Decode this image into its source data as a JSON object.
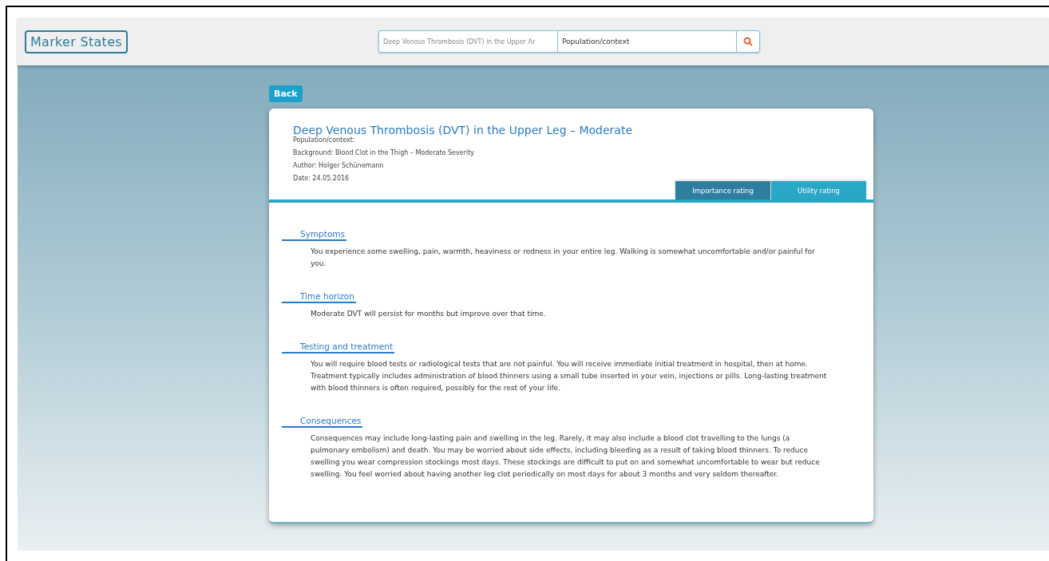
{
  "header": {
    "logo": "Marker States",
    "search": {
      "value_1": "Deep Venous Thrombosis (DVT) in the Upper Ar",
      "value_2": "Population/context"
    }
  },
  "back_button": "Back",
  "card": {
    "title": "Deep Venous Thrombosis (DVT) in the Upper Leg – Moderate",
    "meta": [
      "Population/context:",
      "Background: Blood Clot in the Thigh – Moderate Severity",
      "Author: Holger Schünemann",
      "Date: 24.05.2016"
    ],
    "tabs": [
      {
        "label": "Importance rating",
        "selected": false
      },
      {
        "label": "Utility rating",
        "selected": true
      }
    ],
    "sections": [
      {
        "heading": "Symptoms",
        "text": "You experience some swelling, pain, warmth, heaviness or redness in your entire leg. Walking is somewhat uncomfortable and/or painful for you."
      },
      {
        "heading": "Time horizon",
        "text": "Moderate DVT will persist for months but improve over that time."
      },
      {
        "heading": "Testing and treatment",
        "text": "You will require blood tests or radiological tests that are not painful. You will receive immediate initial treatment in hospital, then at home. Treatment typically includes administration of blood thinners using a small tube inserted in your vein, injections or pills. Long-lasting treatment with blood thinners is often required, possibly for the rest of your life."
      },
      {
        "heading": "Consequences",
        "text": "Consequences may include long-lasting pain and swelling in the leg. Rarely, it may also include a blood clot travelling to the lungs (a pulmonary embolism) and death. You may be worried about side effects, including bleeding as a result of taking blood thinners. To reduce swelling you wear compression stockings most days. These stockings are difficult to put on and somewhat uncomfortable to wear but reduce swelling. You feel worried about having another leg clot periodically on most days for about 3 months and very seldom thereafter."
      }
    ]
  }
}
